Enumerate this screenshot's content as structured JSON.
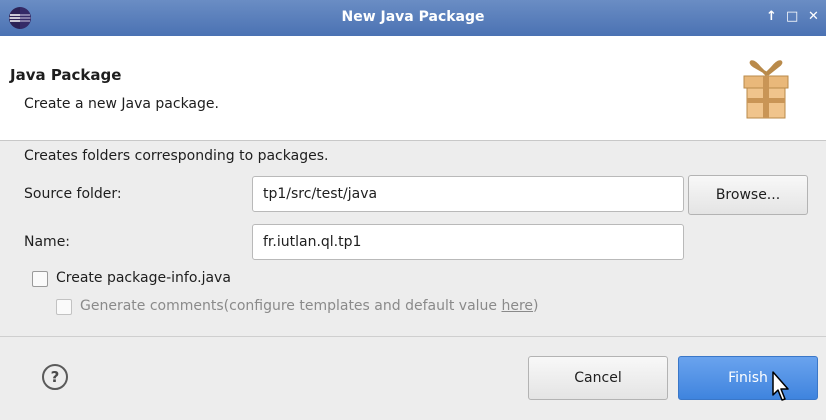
{
  "window": {
    "title": "New Java Package",
    "controls": {
      "pin": "↑",
      "maximize": "□",
      "close": "✕"
    }
  },
  "banner": {
    "heading": "Java Package",
    "description": "Create a new Java package."
  },
  "body": {
    "info": "Creates folders corresponding to packages.",
    "source_folder_label": "Source folder:",
    "source_folder_value": "tp1/src/test/java",
    "browse_label": "Browse...",
    "name_label": "Name:",
    "name_value": "fr.iutlan.ql.tp1",
    "create_package_info_label": "Create package-info.java",
    "generate_comments_label": "Generate comments",
    "generate_comments_hint": "(configure templates and default value ",
    "here_link": "here",
    "hint_close": ")"
  },
  "footer": {
    "help": "?",
    "cancel_label": "Cancel",
    "finish_label": "Finish"
  },
  "colors": {
    "titlebar": "#4b72b3",
    "primary_button": "#4a8ce3",
    "banner_bg": "#ffffff",
    "dialog_bg": "#ededed"
  },
  "icons": [
    "eclipse-app-icon",
    "wizard-gift-icon",
    "help-icon",
    "mouse-cursor-icon"
  ]
}
